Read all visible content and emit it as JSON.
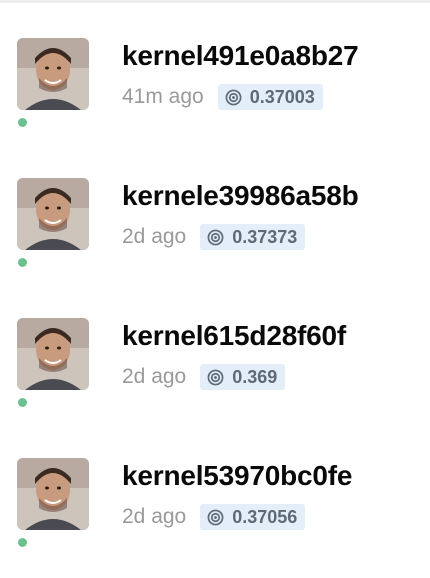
{
  "kernels": [
    {
      "title": "kernel491e0a8b27",
      "time": "41m ago",
      "score": "0.37003"
    },
    {
      "title": "kernele39986a58b",
      "time": "2d ago",
      "score": "0.37373"
    },
    {
      "title": "kernel615d28f60f",
      "time": "2d ago",
      "score": "0.369"
    },
    {
      "title": "kernel53970bc0fe",
      "time": "2d ago",
      "score": "0.37056"
    }
  ],
  "colors": {
    "status_dot": "#6cc28e",
    "score_badge_bg": "#e4eef9",
    "score_text": "#5d6a78",
    "time_text": "#9a9a9a"
  },
  "icons": {
    "status": "status-dot",
    "score": "target-icon"
  }
}
